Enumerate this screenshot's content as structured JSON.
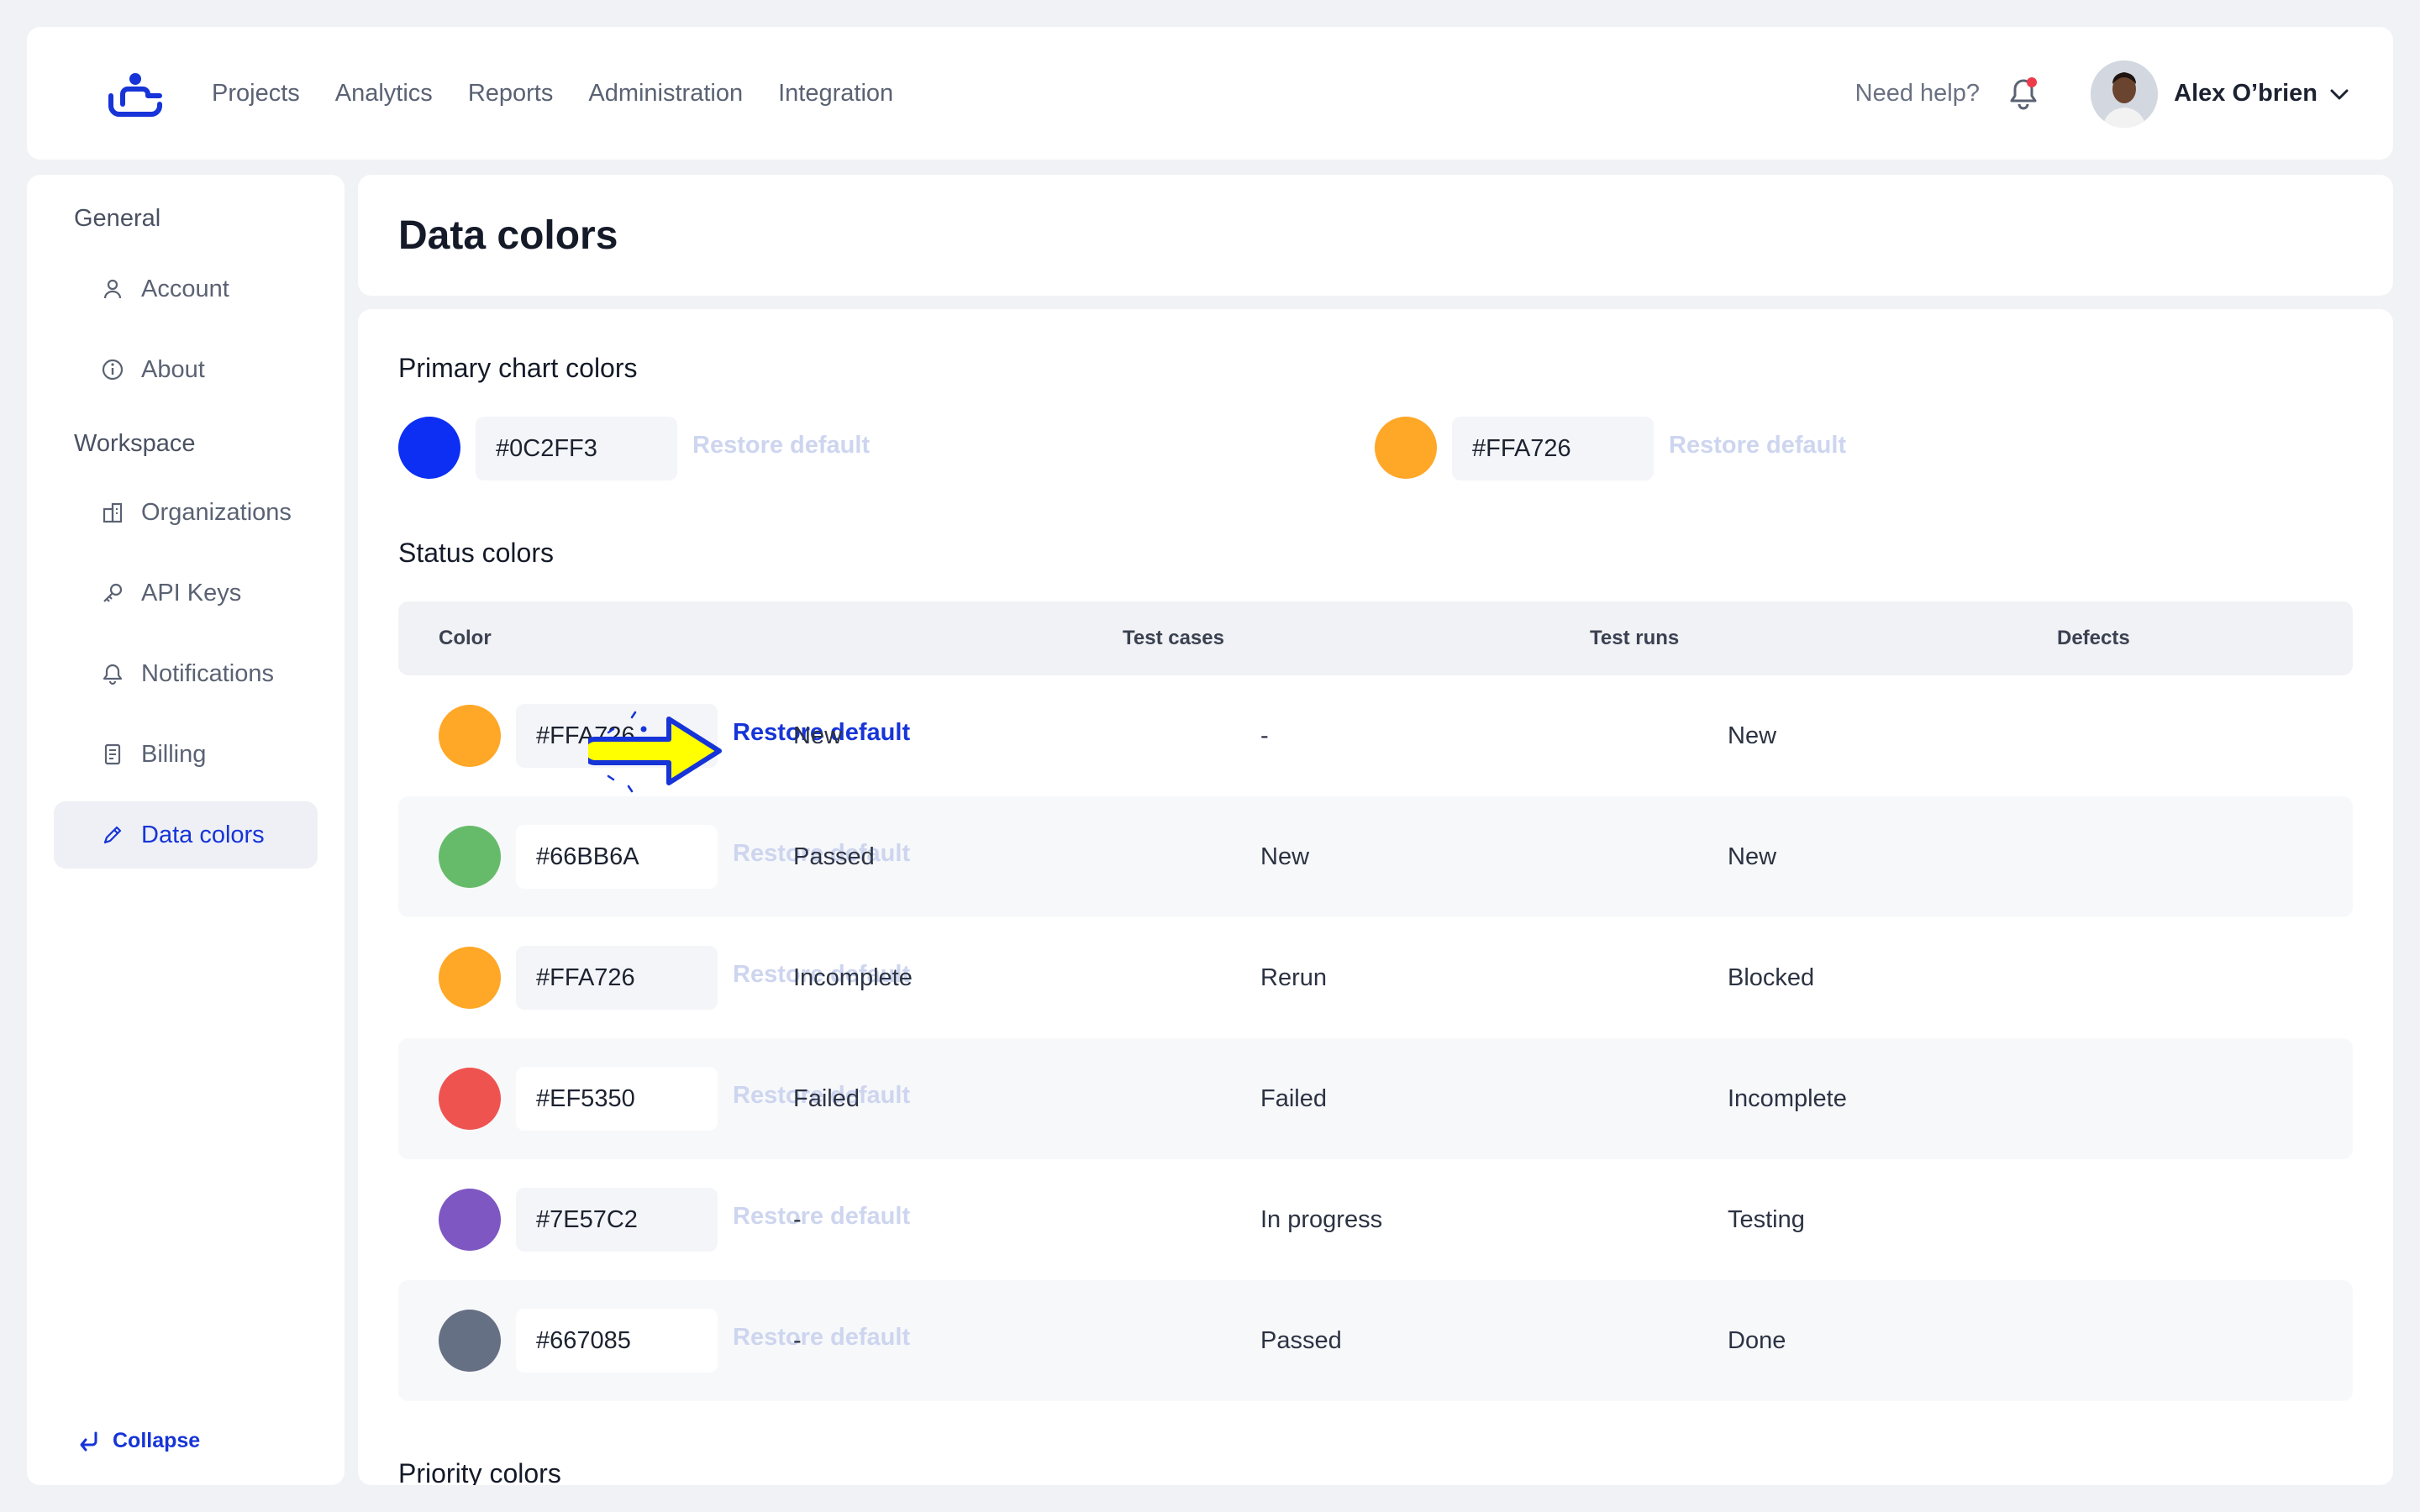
{
  "nav": {
    "items": [
      "Projects",
      "Analytics",
      "Reports",
      "Administration",
      "Integration"
    ],
    "help": "Need help?",
    "user_name": "Alex O’brien"
  },
  "sidebar": {
    "general_label": "General",
    "workspace_label": "Workspace",
    "items": [
      {
        "label": "Account",
        "icon": "user-icon"
      },
      {
        "label": "About",
        "icon": "info-icon"
      },
      {
        "label": "Organizations",
        "icon": "building-icon"
      },
      {
        "label": "API Keys",
        "icon": "key-icon"
      },
      {
        "label": "Notifications",
        "icon": "bell-icon"
      },
      {
        "label": "Billing",
        "icon": "receipt-icon"
      },
      {
        "label": "Data colors",
        "icon": "pen-icon"
      }
    ],
    "collapse": "Collapse"
  },
  "page": {
    "title": "Data colors",
    "primary_title": "Primary chart colors",
    "status_title": "Status colors",
    "priority_title": "Priority colors"
  },
  "primary": [
    {
      "hex": "#0C2FF3",
      "color": "#0C2FF3",
      "restore": "Restore default"
    },
    {
      "hex": "#FFA726",
      "color": "#FFA726",
      "restore": "Restore default"
    }
  ],
  "status_table": {
    "headers": [
      "Color",
      "Test cases",
      "Test runs",
      "Defects"
    ],
    "rows": [
      {
        "hex": "#FFA726",
        "color": "#FFA726",
        "restore": "Restore default",
        "test_cases": "New",
        "test_runs": "-",
        "defects": "New"
      },
      {
        "hex": "#66BB6A",
        "color": "#66BB6A",
        "restore": "Restore default",
        "test_cases": "Passed",
        "test_runs": "New",
        "defects": "New"
      },
      {
        "hex": "#FFA726",
        "color": "#FFA726",
        "restore": "Restore default",
        "test_cases": "Incomplete",
        "test_runs": "Rerun",
        "defects": "Blocked"
      },
      {
        "hex": "#EF5350",
        "color": "#EF5350",
        "restore": "Restore default",
        "test_cases": "Failed",
        "test_runs": "Failed",
        "defects": "Incomplete"
      },
      {
        "hex": "#7E57C2",
        "color": "#7E57C2",
        "restore": "Restore default",
        "test_cases": "-",
        "test_runs": "In progress",
        "defects": "Testing"
      },
      {
        "hex": "#667085",
        "color": "#667085",
        "restore": "Restore default",
        "test_cases": "-",
        "test_runs": "Passed",
        "defects": "Done"
      }
    ]
  },
  "colors": {
    "accent": "#1634D8",
    "muted_link": "#CDD5EF",
    "notification_dot": "#EF3A4A",
    "highlight_arrow": "#FFFF00"
  }
}
